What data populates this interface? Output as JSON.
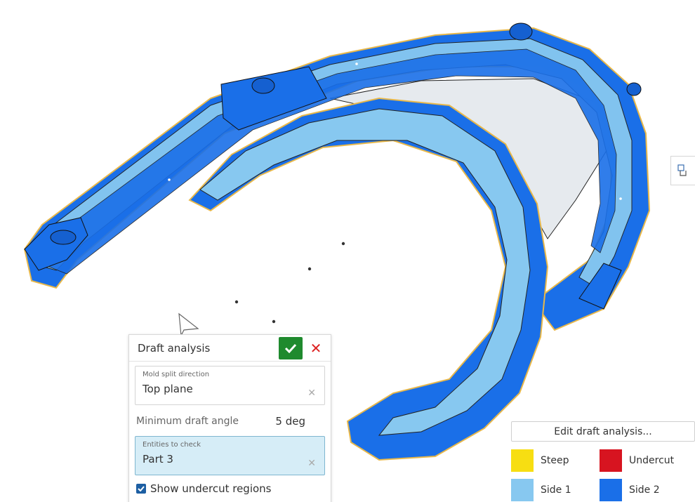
{
  "dialog": {
    "title": "Draft analysis",
    "mold_split": {
      "label": "Mold split direction",
      "value": "Top plane"
    },
    "min_angle": {
      "label": "Minimum draft angle",
      "value": "5 deg"
    },
    "entities": {
      "label": "Entities to check",
      "value": "Part 3"
    },
    "show_undercut": {
      "label": "Show undercut regions",
      "checked": true
    }
  },
  "legend": {
    "edit_label": "Edit draft analysis...",
    "items": [
      {
        "label": "Steep",
        "color": "#f7de12"
      },
      {
        "label": "Undercut",
        "color": "#d71420"
      },
      {
        "label": "Side 1",
        "color": "#87c8f0"
      },
      {
        "label": "Side 2",
        "color": "#1a6fe8"
      }
    ]
  },
  "colors": {
    "side1": "#87c8f0",
    "side2": "#1a6fe8",
    "steep_outline": "#e8b84a",
    "interior": "#e6eaee"
  }
}
